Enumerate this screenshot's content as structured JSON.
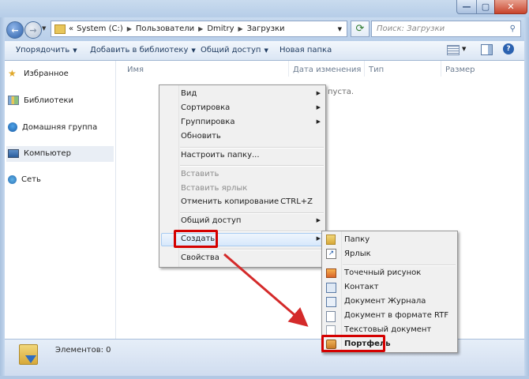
{
  "address": {
    "crumbs": [
      "System (C:)",
      "Пользователи",
      "Dmitry",
      "Загрузки"
    ],
    "lead_sep": "«",
    "search_placeholder": "Поиск: Загрузки"
  },
  "toolbar": {
    "organize": "Упорядочить",
    "add_to_library": "Добавить в библиотеку",
    "share": "Общий доступ",
    "new_folder": "Новая папка"
  },
  "nav": {
    "items": [
      {
        "label": "Избранное",
        "icon": "star-icon"
      },
      {
        "label": "Библиотеки",
        "icon": "library-icon"
      },
      {
        "label": "Домашняя группа",
        "icon": "homegroup-icon"
      },
      {
        "label": "Компьютер",
        "icon": "computer-icon",
        "selected": true
      },
      {
        "label": "Сеть",
        "icon": "network-icon"
      }
    ]
  },
  "columns": [
    "Имя",
    "Дата изменения",
    "Тип",
    "Размер"
  ],
  "empty_text": "пуста.",
  "status": {
    "items": "Элементов: 0"
  },
  "context_menu": {
    "view": "Вид",
    "sort": "Сортировка",
    "group": "Группировка",
    "refresh": "Обновить",
    "customize": "Настроить папку...",
    "paste": "Вставить",
    "paste_shortcut": "Вставить ярлык",
    "undo_copy": "Отменить копирование",
    "undo_copy_shortcut": "CTRL+Z",
    "share": "Общий доступ",
    "create": "Создать",
    "properties": "Свойства"
  },
  "submenu": {
    "folder": "Папку",
    "shortcut": "Ярлык",
    "bitmap": "Точечный рисунок",
    "contact": "Контакт",
    "journal": "Документ Журнала",
    "rtf": "Документ в формате RTF",
    "text": "Текстовый документ",
    "briefcase": "Портфель"
  },
  "colors": {
    "highlight": "#d40000",
    "arrow": "#d42a2a"
  }
}
